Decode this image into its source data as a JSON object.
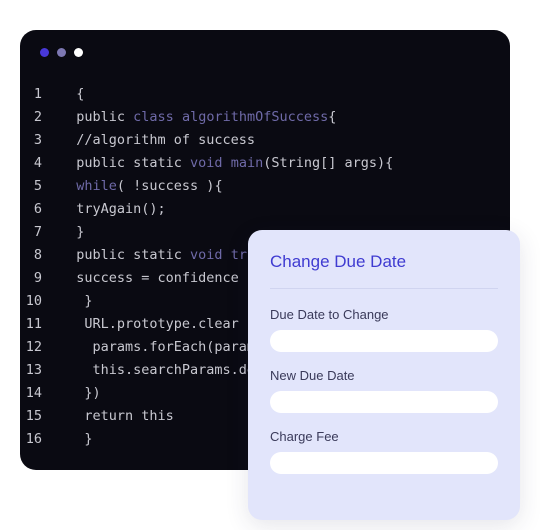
{
  "editor": {
    "dots": [
      "#4838d8",
      "#7d78b3",
      "#ffffff"
    ],
    "lines": [
      {
        "n": 1,
        "tokens": [
          [
            "  {",
            "str"
          ]
        ]
      },
      {
        "n": 2,
        "tokens": [
          [
            "  public ",
            "str"
          ],
          [
            "class ",
            "kw"
          ],
          [
            "algorithmOfSuccess",
            "fn"
          ],
          [
            "{",
            "str"
          ]
        ]
      },
      {
        "n": 3,
        "tokens": [
          [
            "  //algorithm of success",
            "cm"
          ]
        ]
      },
      {
        "n": 4,
        "tokens": [
          [
            "  public static ",
            "str"
          ],
          [
            "void ",
            "kw"
          ],
          [
            "main",
            "fn"
          ],
          [
            "(String[] args){",
            "str"
          ]
        ]
      },
      {
        "n": 5,
        "tokens": [
          [
            "  ",
            "str"
          ],
          [
            "while",
            "kw"
          ],
          [
            "( !success ){",
            "str"
          ]
        ]
      },
      {
        "n": 6,
        "tokens": [
          [
            "  tryAgain();",
            "str"
          ]
        ]
      },
      {
        "n": 7,
        "tokens": [
          [
            "  }",
            "str"
          ]
        ]
      },
      {
        "n": 8,
        "tokens": [
          [
            "  public static ",
            "str"
          ],
          [
            "void ",
            "kw"
          ],
          [
            "tr",
            "fn"
          ]
        ]
      },
      {
        "n": 9,
        "tokens": [
          [
            "  success = confidence ",
            "str"
          ]
        ]
      },
      {
        "n": 10,
        "tokens": [
          [
            "   }",
            "str"
          ]
        ]
      },
      {
        "n": 11,
        "tokens": [
          [
            "   URL.prototype.clear ",
            "str"
          ]
        ]
      },
      {
        "n": 12,
        "tokens": [
          [
            "    params.forEach(param",
            "str"
          ]
        ]
      },
      {
        "n": 13,
        "tokens": [
          [
            "    this.searchParams.de",
            "str"
          ]
        ]
      },
      {
        "n": 14,
        "tokens": [
          [
            "   })",
            "str"
          ]
        ]
      },
      {
        "n": 15,
        "tokens": [
          [
            "   return this",
            "str"
          ]
        ]
      },
      {
        "n": 16,
        "tokens": [
          [
            "   }",
            "str"
          ]
        ]
      }
    ]
  },
  "modal": {
    "title": "Change Due Date",
    "fields": [
      {
        "label": "Due Date to Change",
        "value": ""
      },
      {
        "label": "New Due Date",
        "value": ""
      },
      {
        "label": "Charge Fee",
        "value": ""
      }
    ]
  }
}
